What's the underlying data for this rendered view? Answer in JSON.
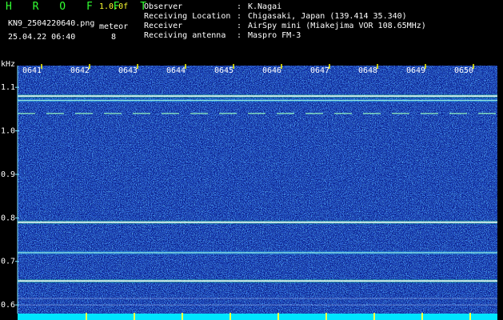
{
  "header": {
    "app_title": "H R O F F T",
    "version": "1.0.0f",
    "filename": "KN9_2504220640.png",
    "datetime": "25.04.22 06:40",
    "mode_label": "meteor",
    "mode_value": "8"
  },
  "metadata": [
    {
      "key": "Observer",
      "sep": ":",
      "value": "K.Nagai"
    },
    {
      "key": "Receiving Location",
      "sep": ":",
      "value": "Chigasaki, Japan (139.414 35.340)"
    },
    {
      "key": "Receiver",
      "sep": ":",
      "value": "AirSpy mini (Miakejima VOR 108.65MHz)"
    },
    {
      "key": "Receiving antenna",
      "sep": ":",
      "value": "Maspro FM-3"
    }
  ],
  "colors": {
    "background": "#000000",
    "title_green": "#32ff32",
    "version_yellow": "#ffff30",
    "tick_yellow": "#ffff00",
    "axis_cyan": "#7fe0ff",
    "noise_floor": "#0a1f8c",
    "bottom_band": "#00e5ff"
  },
  "chart_data": {
    "type": "heatmap",
    "y_unit": "kHz",
    "y_ticks": [
      "1.1",
      "1.0",
      "0.9",
      "0.8",
      "0.7",
      "0.6"
    ],
    "x_ticks": [
      "0641",
      "0642",
      "0643",
      "0644",
      "0645",
      "0646",
      "0647",
      "0648",
      "0649",
      "0650"
    ],
    "ylim": [
      0.58,
      1.15
    ],
    "xlim": [
      0,
      10
    ],
    "signal_lines": [
      {
        "freq_khz": 1.08,
        "intensity": "strong"
      },
      {
        "freq_khz": 1.07,
        "intensity": "medium"
      },
      {
        "freq_khz": 1.04,
        "intensity": "dashed"
      },
      {
        "freq_khz": 0.79,
        "intensity": "strong"
      },
      {
        "freq_khz": 0.72,
        "intensity": "medium"
      },
      {
        "freq_khz": 0.655,
        "intensity": "strong"
      },
      {
        "freq_khz": 0.615,
        "intensity": "faint"
      },
      {
        "freq_khz": 0.6,
        "intensity": "faint"
      }
    ]
  }
}
